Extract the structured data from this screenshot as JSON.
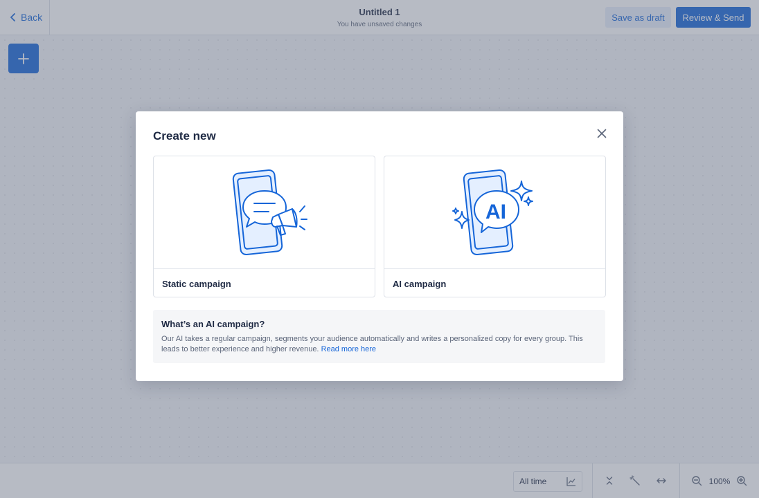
{
  "colors": {
    "accent": "#1565d8",
    "accent_light": "#e7eefb",
    "text_primary": "#1f2a44",
    "text_secondary": "#5c667a",
    "border": "#dde1e8"
  },
  "topbar": {
    "back_label": "Back",
    "title": "Untitled 1",
    "subtitle": "You have unsaved changes",
    "save_draft_label": "Save as draft",
    "review_send_label": "Review & Send"
  },
  "toolbar": {
    "range_label": "All time",
    "zoom_level": "100%"
  },
  "modal": {
    "title": "Create new",
    "cards": [
      {
        "label": "Static campaign",
        "icon": "phone-megaphone-icon"
      },
      {
        "label": "AI campaign",
        "icon": "phone-ai-icon",
        "badge_text": "AI"
      }
    ],
    "info": {
      "title": "What’s an AI campaign?",
      "body": "Our AI takes a regular campaign, segments your audience automatically and writes a personalized copy for every group. This leads to better experience and higher revenue.",
      "link_label": "Read more here"
    }
  }
}
